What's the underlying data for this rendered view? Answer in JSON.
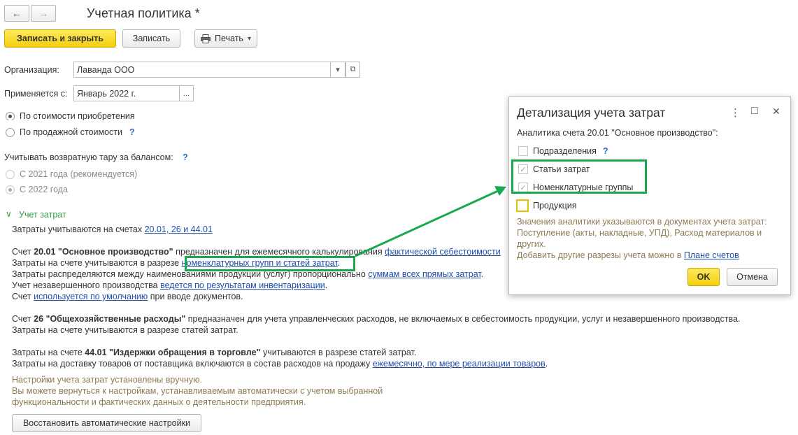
{
  "window": {
    "title": "Учетная политика *",
    "back_icon": "←",
    "forward_icon": "→"
  },
  "toolbar": {
    "save_close_label": "Записать и закрыть",
    "save_label": "Записать",
    "print_label": "Печать",
    "print_arrow": "▾",
    "printer_icon": "printer-icon"
  },
  "form": {
    "org_label": "Организация:",
    "org_value": "Лаванда ООО",
    "org_dropdown_icon": "▾",
    "org_open_icon": "⧉",
    "applies_label": "Применяется с:",
    "applies_value": "Январь 2022 г.",
    "applies_select_icon": "...",
    "radio1_label": "По стоимости приобретения",
    "radio2_label": "По продажной стоимости",
    "q_mark": "?",
    "tara_label": "Учитывать возвратную тару за балансом:",
    "tara_radio1_label": "С 2021 года (рекомендуется)",
    "tara_radio2_label": "С 2022 года"
  },
  "cost_section": {
    "toggle_icon": "∨",
    "header": "Учет затрат",
    "line1_text": "Затраты учитываются на счетах ",
    "line1_link": "20.01, 26 и 44.01",
    "p1_l1_a": "Счет ",
    "p1_l1_bold": "20.01 \"Основное производство\"",
    "p1_l1_b": " предназначен для ежемесячного калькулирования ",
    "p1_l1_link": "фактической себестоимости",
    "p1_l2_a": "Затраты на счете учитываются в разрезе ",
    "p1_l2_link": "номенклатурных групп и статей затрат",
    "p1_l2_b": ".",
    "p1_l3_a": "Затраты распределяются между наименованиями продукции (услуг) пропорционально ",
    "p1_l3_link": "суммам всех прямых затрат",
    "p1_l3_b": ".",
    "p1_l4_a": "Учет незавершенного производства ",
    "p1_l4_link": "ведется по результатам инвентаризации",
    "p1_l4_b": ".",
    "p1_l5_a": "Счет ",
    "p1_l5_link": "используется по умолчанию",
    "p1_l5_b": " при вводе документов.",
    "p2_l1_a": "Счет ",
    "p2_l1_bold": "26 \"Общехозяйственные расходы\"",
    "p2_l1_b": " предназначен для учета управленческих расходов, не включаемых в себестоимость продукции, услуг и незавершенного производства.",
    "p2_l2": "Затраты на счете учитываются в разрезе статей затрат.",
    "p3_l1_a": "Затраты на счете ",
    "p3_l1_bold": "44.01 \"Издержки обращения в торговле\"",
    "p3_l1_b": " учитываются в разрезе статей затрат.",
    "p3_l2_a": "Затраты на доставку товаров от поставщика включаются в состав расходов на продажу ",
    "p3_l2_link": "ежемесячно, по мере реализации товаров",
    "p3_l2_b": ".",
    "note_l1": "Настройки учета затрат установлены вручную.",
    "note_l2": "Вы можете вернуться к настройкам, устанавливаемым автоматически с учетом выбранной",
    "note_l3": "функциональности и фактических данных о деятельности предприятия.",
    "restore_button": "Восстановить автоматические настройки"
  },
  "dialog": {
    "title": "Детализация учета затрат",
    "more_icon": "⋮",
    "maximize_icon": "□",
    "close_icon": "✕",
    "subtitle": "Аналитика счета 20.01 \"Основное производство\":",
    "opt1": "Подразделения",
    "opt1_q": "?",
    "opt2": "Статьи затрат",
    "opt3": "Номенклатурные группы",
    "opt4": "Продукция",
    "check_mark": "✓",
    "note_l1": "Значения аналитики указываются в документах учета затрат:",
    "note_l2": "Поступление (акты, накладные, УПД), Расход материалов и",
    "note_l3": "других.",
    "note_l4_a": "Добавить другие разрезы учета можно в ",
    "note_l4_link": "Плане счетов",
    "ok_label": "OK",
    "cancel_label": "Отмена"
  },
  "colors": {
    "highlight": "#1aa84f",
    "primary_button": "#f5cf0e",
    "link": "#1f4fa8"
  }
}
